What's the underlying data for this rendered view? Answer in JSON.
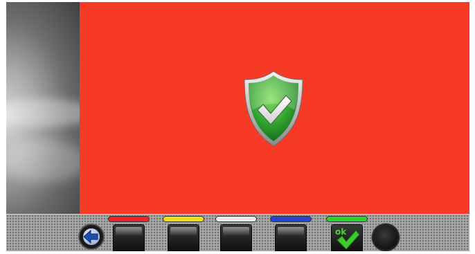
{
  "screen": {
    "name": "confirmation-screen",
    "state": "success"
  },
  "main": {
    "status_icon": "shield-check-icon",
    "status_colors": {
      "background": "#f73a26",
      "shield": "#2ea02e",
      "check": "#ffffff"
    }
  },
  "toolbar": {
    "back_icon": "arrow-left-icon",
    "keys": [
      {
        "name": "red-function-key",
        "color": "#e8262c"
      },
      {
        "name": "yellow-function-key",
        "color": "#f0dd1a"
      },
      {
        "name": "white-function-key",
        "color": "#e9e9e9"
      },
      {
        "name": "blue-function-key",
        "color": "#2446d8"
      },
      {
        "name": "green-ok-key",
        "color": "#2fd12a",
        "label": "ok",
        "icon": "checkmark-icon"
      }
    ],
    "round_button_icon": "circle-icon"
  }
}
